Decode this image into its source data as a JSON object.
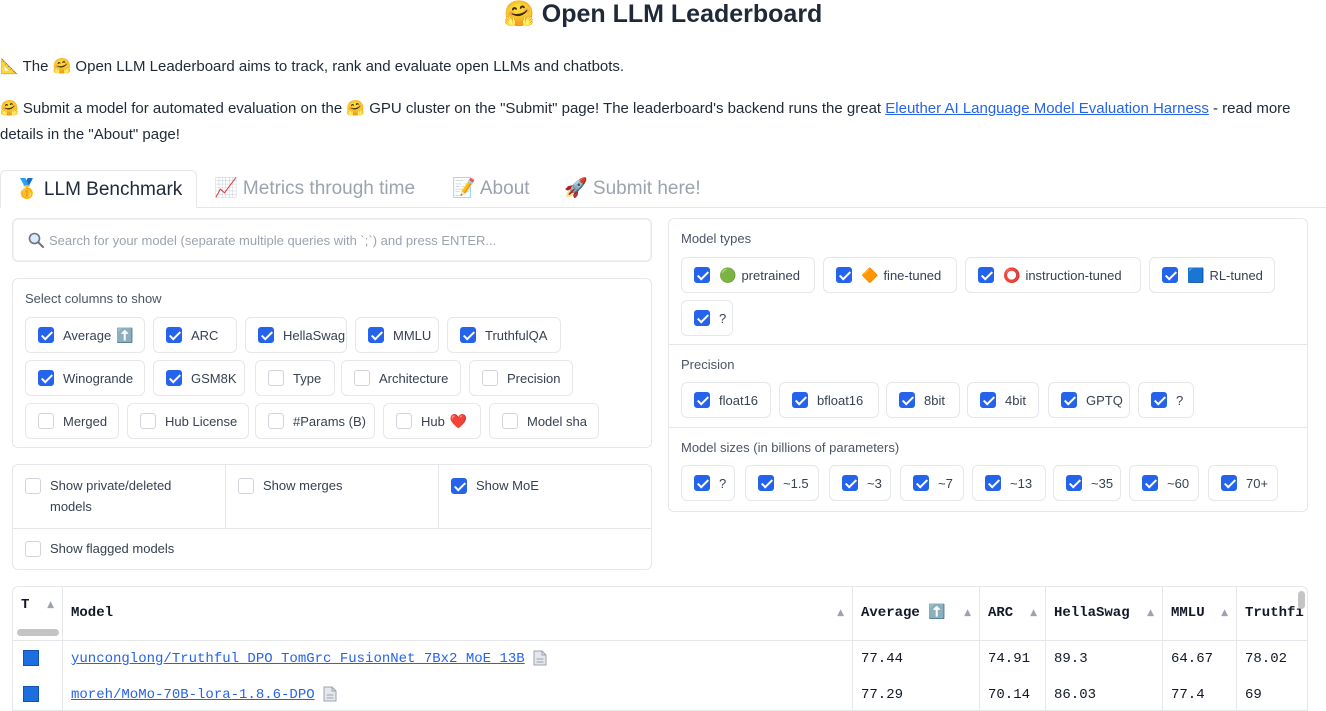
{
  "header": {
    "title": "🤗 Open LLM Leaderboard",
    "intro1": "📐 The 🤗 Open LLM Leaderboard aims to track, rank and evaluate open LLMs and chatbots.",
    "intro2_pre": "🤗 Submit a model for automated evaluation on the 🤗 GPU cluster on the \"Submit\" page! The leaderboard's backend runs the great ",
    "intro2_link": "Eleuther AI Language Model Evaluation Harness",
    "intro2_post": " - read more details in the \"About\" page!"
  },
  "tabs": [
    {
      "label": "🥇 LLM Benchmark"
    },
    {
      "label": "📈 Metrics through time"
    },
    {
      "label": "📝 About"
    },
    {
      "label": "🚀 Submit here!"
    }
  ],
  "search": {
    "placeholder": "Search for your model (separate multiple queries with `;`) and press ENTER..."
  },
  "columns": {
    "label": "Select columns to show",
    "items": [
      {
        "label": "Average",
        "emoji": "⬆️",
        "checked": true
      },
      {
        "label": "ARC",
        "checked": true
      },
      {
        "label": "HellaSwag",
        "checked": true
      },
      {
        "label": "MMLU",
        "checked": true
      },
      {
        "label": "TruthfulQA",
        "checked": true
      },
      {
        "label": "Winogrande",
        "checked": true
      },
      {
        "label": "GSM8K",
        "checked": true
      },
      {
        "label": "Type",
        "checked": false
      },
      {
        "label": "Architecture",
        "checked": false
      },
      {
        "label": "Precision",
        "checked": false
      },
      {
        "label": "Merged",
        "checked": false
      },
      {
        "label": "Hub License",
        "checked": false
      },
      {
        "label": "#Params (B)",
        "checked": false
      },
      {
        "label": "Hub",
        "emoji": "❤️",
        "checked": false
      },
      {
        "label": "Model sha",
        "checked": false
      }
    ]
  },
  "options": {
    "private": {
      "label": "Show private/deleted",
      "label2": "models",
      "checked": false
    },
    "merges": {
      "label": "Show merges",
      "checked": false
    },
    "moe": {
      "label": "Show MoE",
      "checked": true
    },
    "flagged": {
      "label": "Show flagged models",
      "checked": false
    }
  },
  "model_types": {
    "label": "Model types",
    "items": [
      {
        "emoji": "🟢",
        "label": "pretrained",
        "checked": true
      },
      {
        "emoji": "🔶",
        "label": "fine-tuned",
        "checked": true
      },
      {
        "emoji": "⭕",
        "label": "instruction-tuned",
        "checked": true
      },
      {
        "emoji": "🟦",
        "label": "RL-tuned",
        "checked": true
      },
      {
        "label": "?",
        "checked": true
      }
    ]
  },
  "precision": {
    "label": "Precision",
    "items": [
      {
        "label": "float16",
        "checked": true
      },
      {
        "label": "bfloat16",
        "checked": true
      },
      {
        "label": "8bit",
        "checked": true
      },
      {
        "label": "4bit",
        "checked": true
      },
      {
        "label": "GPTQ",
        "checked": true
      },
      {
        "label": "?",
        "checked": true
      }
    ]
  },
  "sizes": {
    "label": "Model sizes (in billions of parameters)",
    "items": [
      {
        "label": "?",
        "checked": true
      },
      {
        "label": "~1.5",
        "checked": true
      },
      {
        "label": "~3",
        "checked": true
      },
      {
        "label": "~7",
        "checked": true
      },
      {
        "label": "~13",
        "checked": true
      },
      {
        "label": "~35",
        "checked": true
      },
      {
        "label": "~60",
        "checked": true
      },
      {
        "label": "70+",
        "checked": true
      }
    ]
  },
  "table": {
    "headers": [
      "T",
      "Model",
      "Average ⬆️",
      "ARC",
      "HellaSwag",
      "MMLU",
      "Truthfi"
    ],
    "sort_glyph": "▲",
    "rows": [
      {
        "type_icon": "rl-tuned",
        "model": "yunconglong/Truthful_DPO_TomGrc_FusionNet_7Bx2_MoE_13B",
        "average": "77.44",
        "arc": "74.91",
        "hellaswag": "89.3",
        "mmlu": "64.67",
        "truthful": "78.02"
      },
      {
        "type_icon": "rl-tuned",
        "model": "moreh/MoMo-70B-lora-1.8.6-DPO",
        "average": "77.29",
        "arc": "70.14",
        "hellaswag": "86.03",
        "mmlu": "77.4",
        "truthful": "69"
      }
    ]
  },
  "colors": {
    "accent": "#2563eb",
    "border": "#e5e7eb",
    "muted": "#9ca3af"
  }
}
